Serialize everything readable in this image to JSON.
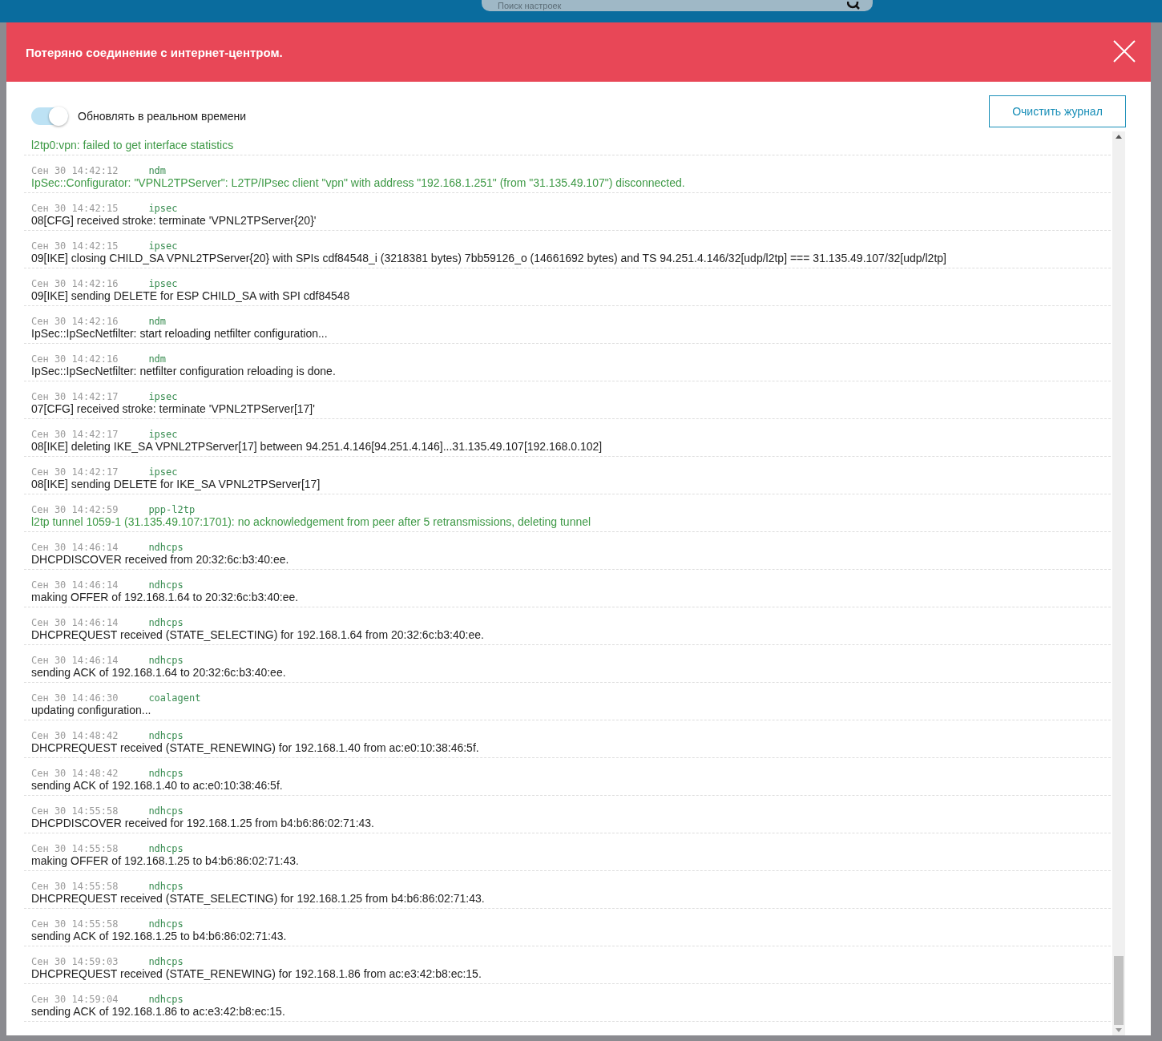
{
  "topbar": {
    "search": {
      "placeholder": "Поиск настроек"
    }
  },
  "dialog": {
    "title": "Потеряно соединение с интернет-центром.",
    "realtime": {
      "label": "Обновлять в реальном времени",
      "on": true
    },
    "clear_button": "Очистить журнал",
    "log": [
      {
        "kind": "notice",
        "message": "l2tp0:vpn: failed to get interface statistics"
      },
      {
        "kind": "notice",
        "time": "Сен 30 14:42:12",
        "source": "ndm",
        "message": "IpSec::Configurator: \"VPNL2TPServer\": L2TP/IPsec client \"vpn\" with address \"192.168.1.251\" (from \"31.135.49.107\") disconnected."
      },
      {
        "kind": "info",
        "time": "Сен 30 14:42:15",
        "source": "ipsec",
        "message": "08[CFG] received stroke: terminate 'VPNL2TPServer{20}'"
      },
      {
        "kind": "info",
        "time": "Сен 30 14:42:15",
        "source": "ipsec",
        "message": "09[IKE] closing CHILD_SA VPNL2TPServer{20} with SPIs cdf84548_i (3218381 bytes) 7bb59126_o (14661692 bytes) and TS 94.251.4.146/32[udp/l2tp] === 31.135.49.107/32[udp/l2tp]"
      },
      {
        "kind": "info",
        "time": "Сен 30 14:42:16",
        "source": "ipsec",
        "message": "09[IKE] sending DELETE for ESP CHILD_SA with SPI cdf84548"
      },
      {
        "kind": "info",
        "time": "Сен 30 14:42:16",
        "source": "ndm",
        "message": "IpSec::IpSecNetfilter: start reloading netfilter configuration..."
      },
      {
        "kind": "info",
        "time": "Сен 30 14:42:16",
        "source": "ndm",
        "message": "IpSec::IpSecNetfilter: netfilter configuration reloading is done."
      },
      {
        "kind": "info",
        "time": "Сен 30 14:42:17",
        "source": "ipsec",
        "message": "07[CFG] received stroke: terminate 'VPNL2TPServer[17]'"
      },
      {
        "kind": "info",
        "time": "Сен 30 14:42:17",
        "source": "ipsec",
        "message": "08[IKE] deleting IKE_SA VPNL2TPServer[17] between 94.251.4.146[94.251.4.146]...31.135.49.107[192.168.0.102]"
      },
      {
        "kind": "info",
        "time": "Сен 30 14:42:17",
        "source": "ipsec",
        "message": "08[IKE] sending DELETE for IKE_SA VPNL2TPServer[17]"
      },
      {
        "kind": "notice",
        "time": "Сен 30 14:42:59",
        "source": "ppp-l2tp",
        "message": "l2tp tunnel 1059-1 (31.135.49.107:1701): no acknowledgement from peer after 5 retransmissions, deleting tunnel"
      },
      {
        "kind": "info",
        "time": "Сен 30 14:46:14",
        "source": "ndhcps",
        "message": "DHCPDISCOVER received from 20:32:6c:b3:40:ee."
      },
      {
        "kind": "info",
        "time": "Сен 30 14:46:14",
        "source": "ndhcps",
        "message": "making OFFER of 192.168.1.64 to 20:32:6c:b3:40:ee."
      },
      {
        "kind": "info",
        "time": "Сен 30 14:46:14",
        "source": "ndhcps",
        "message": "DHCPREQUEST received (STATE_SELECTING) for 192.168.1.64 from 20:32:6c:b3:40:ee."
      },
      {
        "kind": "info",
        "time": "Сен 30 14:46:14",
        "source": "ndhcps",
        "message": "sending ACK of 192.168.1.64 to 20:32:6c:b3:40:ee."
      },
      {
        "kind": "info",
        "time": "Сен 30 14:46:30",
        "source": "coalagent",
        "message": "updating configuration..."
      },
      {
        "kind": "info",
        "time": "Сен 30 14:48:42",
        "source": "ndhcps",
        "message": "DHCPREQUEST received (STATE_RENEWING) for 192.168.1.40 from ac:e0:10:38:46:5f."
      },
      {
        "kind": "info",
        "time": "Сен 30 14:48:42",
        "source": "ndhcps",
        "message": "sending ACK of 192.168.1.40 to ac:e0:10:38:46:5f."
      },
      {
        "kind": "info",
        "time": "Сен 30 14:55:58",
        "source": "ndhcps",
        "message": "DHCPDISCOVER received for 192.168.1.25 from b4:b6:86:02:71:43."
      },
      {
        "kind": "info",
        "time": "Сен 30 14:55:58",
        "source": "ndhcps",
        "message": "making OFFER of 192.168.1.25 to b4:b6:86:02:71:43."
      },
      {
        "kind": "info",
        "time": "Сен 30 14:55:58",
        "source": "ndhcps",
        "message": "DHCPREQUEST received (STATE_SELECTING) for 192.168.1.25 from b4:b6:86:02:71:43."
      },
      {
        "kind": "info",
        "time": "Сен 30 14:55:58",
        "source": "ndhcps",
        "message": "sending ACK of 192.168.1.25 to b4:b6:86:02:71:43."
      },
      {
        "kind": "info",
        "time": "Сен 30 14:59:03",
        "source": "ndhcps",
        "message": "DHCPREQUEST received (STATE_RENEWING) for 192.168.1.86 from ac:e3:42:b8:ec:15."
      },
      {
        "kind": "info",
        "time": "Сен 30 14:59:04",
        "source": "ndhcps",
        "message": "sending ACK of 192.168.1.86 to ac:e3:42:b8:ec:15."
      }
    ]
  }
}
